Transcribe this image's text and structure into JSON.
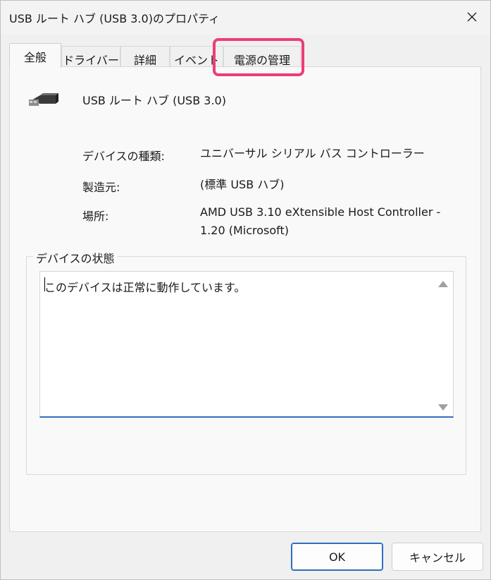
{
  "window": {
    "title": "USB ルート ハブ (USB 3.0)のプロパティ"
  },
  "tabs": [
    {
      "label": "全般",
      "active": true
    },
    {
      "label": "ドライバー",
      "active": false
    },
    {
      "label": "詳細",
      "active": false
    },
    {
      "label": "イベント",
      "active": false
    },
    {
      "label": "電源の管理",
      "active": false,
      "highlighted": true
    }
  ],
  "device": {
    "icon": "usb-plug-icon",
    "name": "USB ルート ハブ (USB 3.0)"
  },
  "properties": [
    {
      "label": "デバイスの種類:",
      "value": "ユニバーサル シリアル バス コントローラー"
    },
    {
      "label": "製造元:",
      "value": "(標準 USB ハブ)"
    },
    {
      "label": "場所:",
      "value": "AMD USB 3.10 eXtensible Host Controller - 1.20 (Microsoft)"
    }
  ],
  "status": {
    "group_label": "デバイスの状態",
    "text": "このデバイスは正常に動作しています。"
  },
  "buttons": {
    "ok": "OK",
    "cancel": "キャンセル"
  },
  "colors": {
    "highlight": "#ec3d7a",
    "accent": "#2f6fbf"
  }
}
